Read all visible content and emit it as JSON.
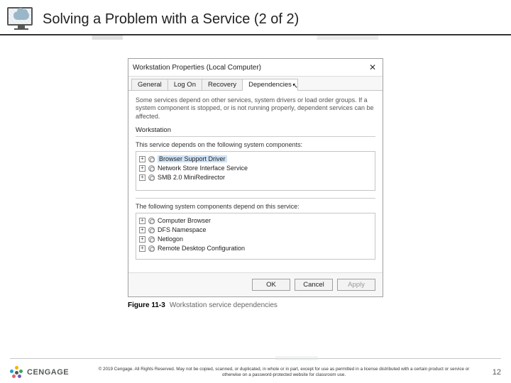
{
  "header": {
    "title": "Solving a Problem with a Service (2 of 2)"
  },
  "dialog": {
    "title": "Workstation Properties (Local Computer)",
    "close_glyph": "✕",
    "tabs": [
      "General",
      "Log On",
      "Recovery",
      "Dependencies"
    ],
    "active_tab": 3,
    "intro": "Some services depend on other services, system drivers or load order groups. If a system component is stopped, or is not running properly, dependent services can be affected.",
    "section1_label": "Workstation",
    "depends_on_text": "This service depends on the following system components:",
    "depends_on": [
      {
        "label": "Browser Support Driver",
        "selected": true
      },
      {
        "label": "Network Store Interface Service",
        "selected": false
      },
      {
        "label": "SMB 2.0 MiniRedirector",
        "selected": false
      }
    ],
    "dependents_text": "The following system components depend on this service:",
    "dependents": [
      {
        "label": "Computer Browser"
      },
      {
        "label": "DFS Namespace"
      },
      {
        "label": "Netlogon"
      },
      {
        "label": "Remote Desktop Configuration"
      }
    ],
    "buttons": {
      "ok": "OK",
      "cancel": "Cancel",
      "apply": "Apply"
    }
  },
  "figure": {
    "number": "Figure 11-3",
    "caption": "Workstation service dependencies"
  },
  "footer": {
    "brand": "CENGAGE",
    "copyright": "© 2019 Cengage. All Rights Reserved. May not be copied, scanned, or duplicated, in whole or in part, except for use as permitted in a license distributed with a certain product or service or otherwise on a password-protected website for classroom use.",
    "page": "12"
  }
}
